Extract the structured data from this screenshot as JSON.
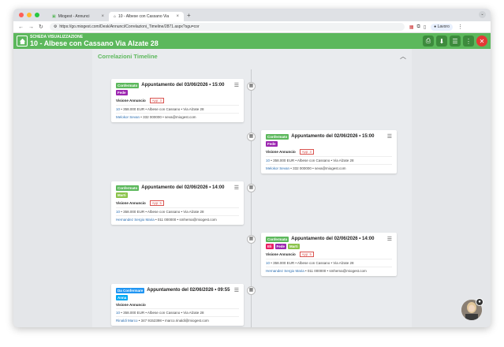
{
  "browser": {
    "tabs": [
      {
        "title": "Miogest - Annunci",
        "active": false
      },
      {
        "title": "10 - Albese con Cassano Via",
        "active": true
      }
    ],
    "url": "https://go.miogest.com/Desk/Annunci/Correlazioni_Timeline/2871.aspx?sgu=cor",
    "profile": "Lavoro"
  },
  "header": {
    "subtitle": "SCHEDA VISUALIZZAZIONE",
    "title": "10 - Albese con Cassano Via Alzate 28"
  },
  "section": {
    "title": "Correlazioni Timeline"
  },
  "cards": [
    {
      "status": "Confermato",
      "status_color": "#5cb85c",
      "title": "Appuntamento del 03/06/2026 • 15:00",
      "tags": [
        {
          "label": "Fede",
          "color": "#9c27b0"
        }
      ],
      "visione_label": "Visione Annuncio",
      "appuntamento": "App: 3",
      "ref": "10",
      "details": " • 358.000 EUR • Albese con Cassano • Via Alzate 28",
      "contact_name": "Melokor Sevan",
      "contact_info": " • 332 000000 • seva@miogest.com"
    },
    {
      "status": "Confermato",
      "status_color": "#5cb85c",
      "title": "Appuntamento del 02/06/2026 • 15:00",
      "tags": [
        {
          "label": "Fede",
          "color": "#9c27b0"
        }
      ],
      "visione_label": "Visione Annuncio",
      "appuntamento": "App: 3",
      "ref": "10",
      "details": " • 358.000 EUR • Albese con Cassano • Via Alzate 28",
      "contact_name": "Melokor Sevan",
      "contact_info": " • 332 000000 • seva@miogest.com"
    },
    {
      "status": "Confermato",
      "status_color": "#5cb85c",
      "title": "Appuntamento del 02/06/2026 • 14:00",
      "tags": [
        {
          "label": "Marti",
          "color": "#8bc34a"
        }
      ],
      "visione_label": "Visione Annuncio",
      "appuntamento": "App: 5",
      "ref": "10",
      "details": " • 358.000 EUR • Albese con Cassano • Via Alzate 28",
      "contact_name": "Hernandez Sergio Maria",
      "contact_info": " • 011 000000 • smhema@miogest.com"
    },
    {
      "status": "Confermato",
      "status_color": "#5cb85c",
      "title": "Appuntamento del 02/06/2026 • 14:00",
      "tags": [
        {
          "label": "Eli",
          "color": "#e91e63"
        },
        {
          "label": "Fede",
          "color": "#9c27b0"
        },
        {
          "label": "Marti",
          "color": "#8bc34a"
        }
      ],
      "visione_label": "Visione Annuncio",
      "appuntamento": "App: 5",
      "ref": "10",
      "details": " • 358.000 EUR • Albese con Cassano • Via Alzate 28",
      "contact_name": "Hernandez Sergio Maria",
      "contact_info": " • 011 000000 • smhema@miogest.com"
    },
    {
      "status": "Da Confermare",
      "status_color": "#2196f3",
      "title": "Appuntamento del 02/06/2026 • 09:55",
      "tags": [
        {
          "label": "Anna",
          "color": "#03a9f4"
        }
      ],
      "visione_label": "Visione Annuncio",
      "appuntamento": "",
      "ref": "10",
      "details": " • 358.000 EUR • Albese con Cassano • Via Alzate 28",
      "contact_name": "Rinaldi Marco",
      "contact_info": " • 347 9152398 • marco.rinaldi@miogest.com"
    }
  ],
  "icons": {
    "home": "home-icon",
    "print": "printer-icon",
    "download": "download-icon",
    "list": "list-icon",
    "more": "more-vert-icon",
    "close": "close-icon",
    "calendar": "calendar-icon",
    "menu": "hamburger-icon"
  },
  "colors": {
    "brand_green": "#5cb85c",
    "close_red": "#e53935",
    "link_blue": "#2a6db0"
  }
}
